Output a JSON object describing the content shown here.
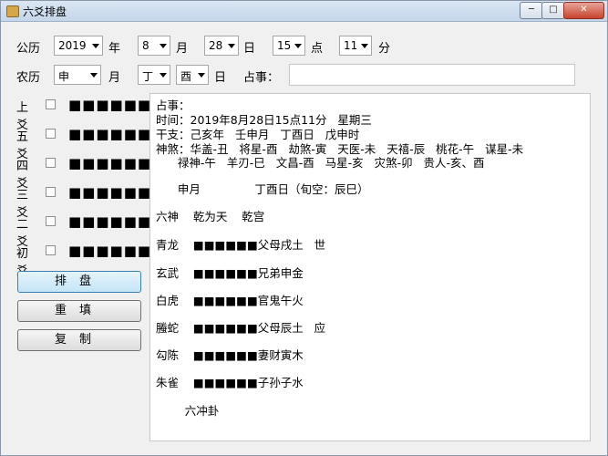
{
  "window": {
    "title": "六爻排盘",
    "min_label": "─",
    "max_label": "□",
    "close_label": "✕"
  },
  "solar": {
    "label": "公历",
    "year": "2019",
    "year_unit": "年",
    "month": "8",
    "month_unit": "月",
    "day": "28",
    "day_unit": "日",
    "hour": "15",
    "hour_unit": "点",
    "minute": "11",
    "minute_unit": "分"
  },
  "lunar": {
    "label": "农历",
    "month_branch": "申",
    "month_unit": "月",
    "day_stem": "丁",
    "day_branch": "酉",
    "day_unit": "日",
    "matter_label": "占事："
  },
  "yao_rows": [
    {
      "label": "上爻",
      "bars": "■■■■■■"
    },
    {
      "label": "五爻",
      "bars": "■■■■■■"
    },
    {
      "label": "四爻",
      "bars": "■■■■■■"
    },
    {
      "label": "三爻",
      "bars": "■■■■■■"
    },
    {
      "label": "二爻",
      "bars": "■■■■■■"
    },
    {
      "label": "初爻",
      "bars": "■■■■■■"
    }
  ],
  "buttons": {
    "arrange": "排盘",
    "refill": "重填",
    "copy": "复制"
  },
  "output": {
    "lines": [
      "占事：",
      "时间：2019年8月28日15点11分   星期三",
      "干支：己亥年   壬申月   丁酉日   戊申时",
      "神煞：华盖-丑   将星-酉   劫煞-寅   天医-未   天禧-辰   桃花-午   谋星-未",
      "      禄神-午   羊刃-巳   文昌-酉   马星-亥   灾煞-卯   贵人-亥、酉",
      "      申月               丁酉日（旬空：辰巳）",
      "六神    乾为天    乾宫",
      "青龙    ■■■■■■父母戌土   世",
      "玄武    ■■■■■■兄弟申金",
      "白虎    ■■■■■■官鬼午火",
      "螣蛇    ■■■■■■父母辰土   应",
      "勾陈    ■■■■■■妻财寅木",
      "朱雀    ■■■■■■子孙子水",
      "        六冲卦"
    ]
  }
}
